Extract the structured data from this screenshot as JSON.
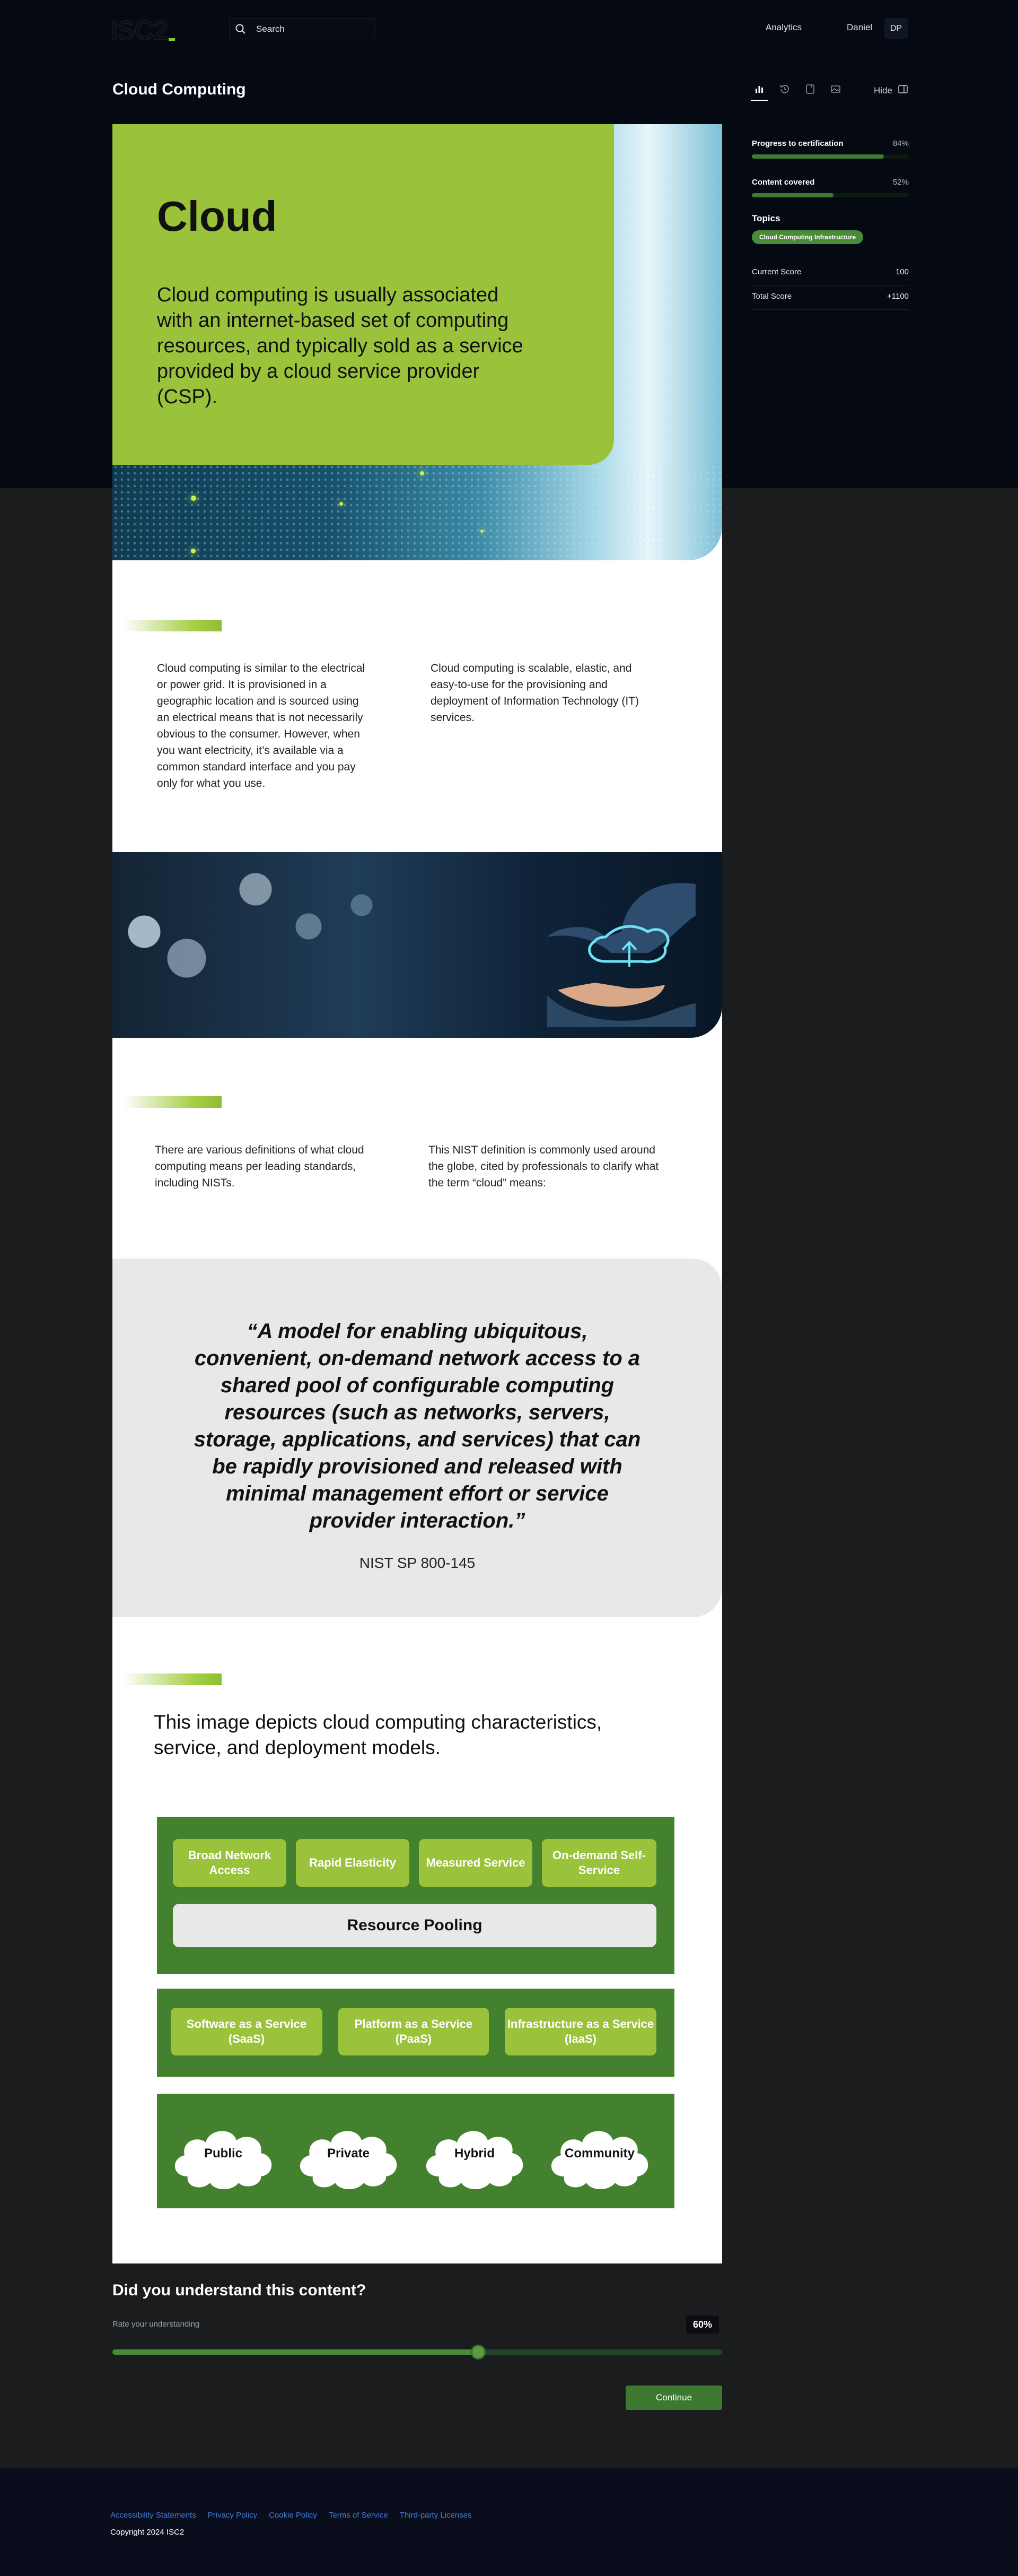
{
  "header": {
    "logo_text": "ISC2",
    "search_placeholder": "Search",
    "analytics_label": "Analytics",
    "username": "Daniel",
    "avatar_initials": "DP"
  },
  "page": {
    "title": "Cloud Computing",
    "hide_label": "Hide"
  },
  "sidebar": {
    "progress_label": "Progress to certification",
    "progress_value": "84%",
    "progress_fraction": 0.84,
    "content_label": "Content covered",
    "content_value": "52%",
    "content_fraction": 0.52,
    "topics_title": "Topics",
    "topic_badge": "Cloud Computing Infrastructure",
    "current_score_label": "Current Score",
    "current_score_value": "100",
    "total_score_label": "Total Score",
    "total_score_value": "+1100"
  },
  "content": {
    "hero_title": "Cloud",
    "hero_subtitle": "Cloud computing is usually associated with an internet-based set of computing resources, and typically sold as a service provided by a cloud service provider (CSP).",
    "para_1_left": "Cloud computing is similar to the electrical or power grid. It is provisioned in a geographic location and is sourced using an electrical means that is not necessarily obvious to the consumer. However, when you want electricity, it’s available via a common standard interface and you pay only for what you use.",
    "para_1_right": "Cloud computing is scalable, elastic, and easy-to-use for the provisioning and deployment of Information Technology (IT) services.",
    "para_2_left": "There are various definitions of what cloud computing means per leading standards, including NISTs.",
    "para_2_right": "This NIST definition is commonly used around the globe, cited by professionals to clarify what the term “cloud” means:",
    "quote": "“A model for enabling ubiquitous, convenient, on-demand network access to a shared pool of configurable computing resources (such as networks, servers, storage, applications, and services) that can be rapidly provisioned and released with minimal management effort or service provider interaction.”",
    "quote_source": "NIST SP 800-145",
    "diagram_heading": "This image depicts cloud computing characteristics, service, and deployment models.",
    "characteristics": [
      "Broad Network Access",
      "Rapid Elasticity",
      "Measured Service",
      "On-demand Self-Service"
    ],
    "pooling": "Resource Pooling",
    "service_models": [
      "Software as a Service (SaaS)",
      "Platform as a Service (PaaS)",
      "Infrastructure as a Service (IaaS)"
    ],
    "deployment_models": [
      "Public",
      "Private",
      "Hybrid",
      "Community"
    ]
  },
  "understanding": {
    "title": "Did you understand this content?",
    "rate_label": "Rate your understanding",
    "rate_value": "60%",
    "rate_fraction": 0.6,
    "continue_label": "Continue"
  },
  "footer": {
    "links": [
      "Accessibility Statements",
      "Privacy Policy",
      "Cookie Policy",
      "Terms of Service",
      "Third-party Licenses"
    ],
    "copyright": "Copyright 2024 ISC2"
  },
  "colors": {
    "accent_green": "#9bc23b",
    "dark_green": "#43812f",
    "link_blue": "#3f7bd6",
    "page_dark": "#050a12"
  }
}
